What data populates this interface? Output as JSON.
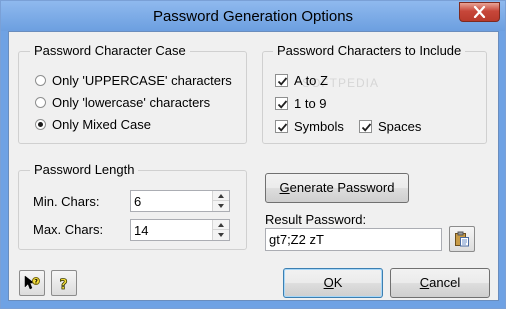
{
  "window": {
    "title": "Password Generation Options",
    "close_icon": "close-x-icon"
  },
  "watermark": "SOFTPEDIA",
  "case_group": {
    "title": "Password Character Case",
    "options": [
      {
        "label": "Only 'UPPERCASE' characters",
        "checked": false
      },
      {
        "label": "Only 'lowercase' characters",
        "checked": false
      },
      {
        "label": "Only Mixed Case",
        "checked": true
      }
    ]
  },
  "include_group": {
    "title": "Password Characters to Include",
    "items": [
      {
        "label": "A to Z",
        "checked": true
      },
      {
        "label": "1 to 9",
        "checked": true
      },
      {
        "label": "Symbols",
        "checked": true
      },
      {
        "label": "Spaces",
        "checked": true
      }
    ]
  },
  "length_group": {
    "title": "Password Length",
    "min_label": "Min. Chars:",
    "min_value": "6",
    "max_label": "Max. Chars:",
    "max_value": "14"
  },
  "generate": {
    "label_underlined": "G",
    "label_rest": "enerate Password"
  },
  "result": {
    "label": "Result Password:",
    "value": "gt7;Z2 zT",
    "copy_icon": "clipboard-paste-icon"
  },
  "bottom_icons": {
    "whats_this_icon": "pointer-help-icon",
    "help_icon": "help-question-icon"
  },
  "ok": {
    "label_underlined": "O",
    "label_rest": "K"
  },
  "cancel": {
    "label_underlined": "C",
    "label_rest": "ancel"
  },
  "colors": {
    "titlebar": "#8fb9ee",
    "client_bg": "#f0f0f0",
    "close_button": "#c7473a"
  }
}
